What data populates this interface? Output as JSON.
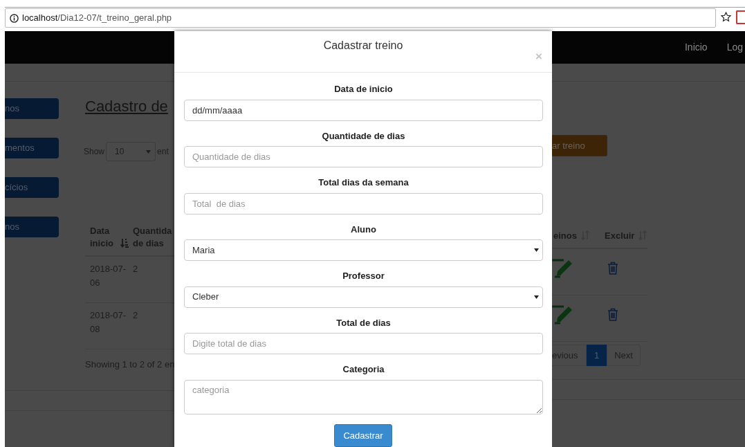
{
  "browser": {
    "url": {
      "host": "localhost",
      "path": "/Dia12-07/t_treino_geral.php"
    }
  },
  "navbar": {
    "items": [
      "Inicio",
      "Log"
    ]
  },
  "sidebar": {
    "items": [
      "nos",
      "mentos",
      "cícios",
      "nos"
    ]
  },
  "page": {
    "title": "Cadastro de",
    "show_label": "Show",
    "page_size": "10",
    "entries_label": "ent",
    "add_button": "ar treino"
  },
  "table": {
    "columns": [
      {
        "label": "Data inicio",
        "sortable": true,
        "sorted": true
      },
      {
        "label": "Quantida de dias"
      },
      {
        "label": "einos",
        "sortable": true,
        "sorted": false
      },
      {
        "label": "Excluir",
        "sortable": true,
        "sorted": false
      }
    ],
    "rows": [
      {
        "data_inicio": "2018-07-06",
        "quantidade": "2"
      },
      {
        "data_inicio": "2018-07-08",
        "quantidade": "2"
      }
    ]
  },
  "info": "Showing 1 to 2 of 2 en",
  "pagination": [
    {
      "label": "evious",
      "selected": false
    },
    {
      "label": "1",
      "selected": true
    },
    {
      "label": "Next",
      "selected": false
    }
  ],
  "modal": {
    "title": "Cadastrar treino",
    "close": "×",
    "fields": [
      {
        "label": "Data de inicio",
        "kind": "input",
        "value": "dd/mm/aaaa"
      },
      {
        "label": "Quantidade de dias",
        "kind": "input",
        "placeholder": "Quantidade de dias"
      },
      {
        "label": "Total dias da semana",
        "kind": "input",
        "placeholder": "Total  de dias"
      },
      {
        "label": "Aluno",
        "kind": "select",
        "value": "Maria"
      },
      {
        "label": "Professor",
        "kind": "select",
        "value": "Cleber"
      },
      {
        "label": "Total de dias",
        "kind": "input",
        "placeholder": "Digite total de dias"
      },
      {
        "label": "Categoria",
        "kind": "textarea",
        "placeholder": "categoria"
      }
    ],
    "submit": "Cadastrar"
  }
}
